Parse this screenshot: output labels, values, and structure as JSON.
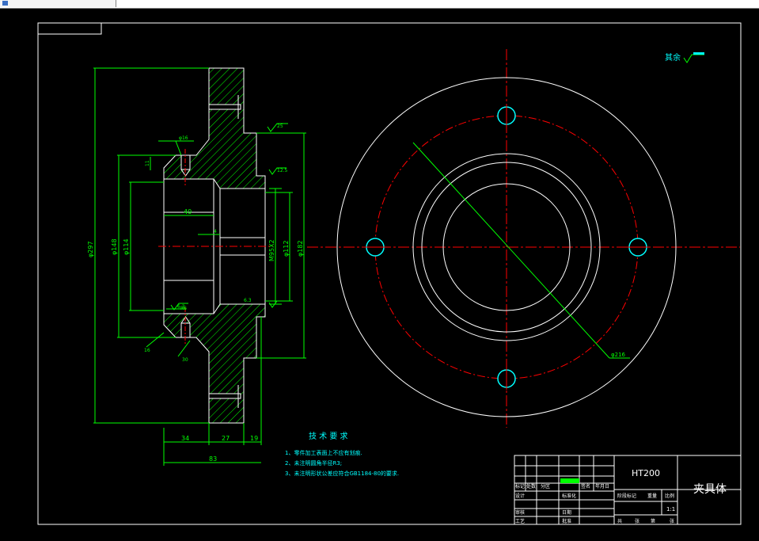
{
  "colors": {
    "background": "#000000",
    "frame": "#ffffff",
    "section_outline": "#ffffff",
    "hatch": "#00ff00",
    "dimension": "#00ff00",
    "center_line": "#ff0000",
    "hole": "#00ffff",
    "notes": "#00ffff",
    "title_block": "#ffffff"
  },
  "toolbar": {
    "icon": "document-icon"
  },
  "section_view": {
    "dims_vertical": [
      "φ297",
      "φ148",
      "φ114",
      "M95X2",
      "φ112",
      "φ182"
    ],
    "dims_horizontal": [
      "40",
      "34",
      "27",
      "19",
      "83"
    ],
    "small_labels": [
      "φ16",
      "4",
      "11",
      "16",
      "30",
      "R6"
    ],
    "roughness_marks": [
      "25",
      "12.5",
      "6.3",
      "6.3"
    ]
  },
  "top_view": {
    "pcd_label": "φ216"
  },
  "roughness_note": "其余",
  "tech_requirements": {
    "heading": "技 术 要 求",
    "items": [
      "1、零件加工表面上不应有划痕.",
      "2、未注明圆角半径R3;",
      "3、未注明形状公差应符合GB1184-80的要求."
    ]
  },
  "title_block": {
    "material": "HT200",
    "part_name": "夹具体",
    "scale": "1:1",
    "row_labels": [
      "标记",
      "处数",
      "分区",
      "更改文件号",
      "签名",
      "年月日"
    ],
    "left_labels": [
      "设计",
      "审核",
      "工艺"
    ],
    "mid_labels": [
      "标准化",
      "批准",
      "日期"
    ],
    "stage_labels": [
      "阶段标记",
      "重量",
      "比例"
    ],
    "sheet_labels": [
      "共",
      "张",
      "第",
      "张"
    ]
  }
}
